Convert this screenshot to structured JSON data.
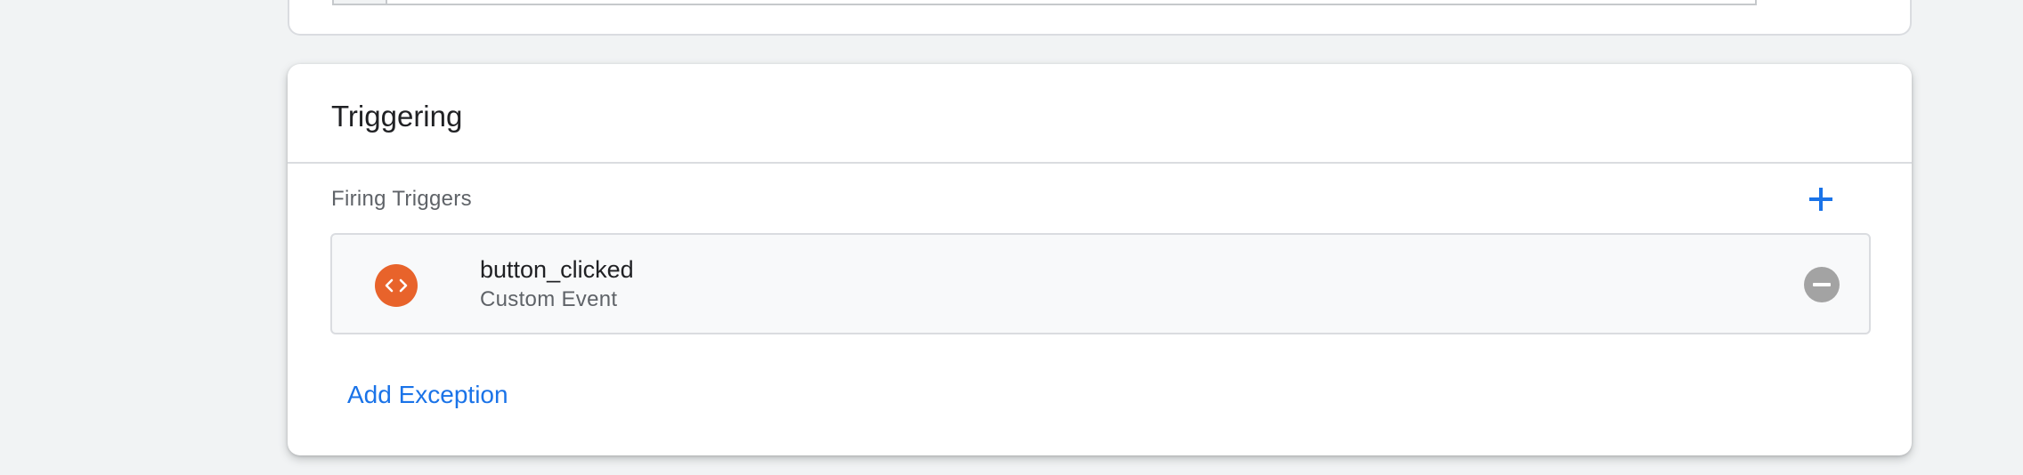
{
  "colors": {
    "accent": "#1a73e8",
    "trigger_icon_bg": "#e8632b",
    "remove_icon_bg": "#a3a3a3",
    "page_bg": "#f1f3f4"
  },
  "triggering": {
    "title": "Triggering",
    "firing_triggers_label": "Firing Triggers",
    "add_trigger_icon": "plus-icon",
    "triggers": [
      {
        "icon": "code-brackets-icon",
        "name": "button_clicked",
        "type": "Custom Event",
        "remove_icon": "remove-circle-icon"
      }
    ],
    "add_exception_label": "Add Exception"
  }
}
